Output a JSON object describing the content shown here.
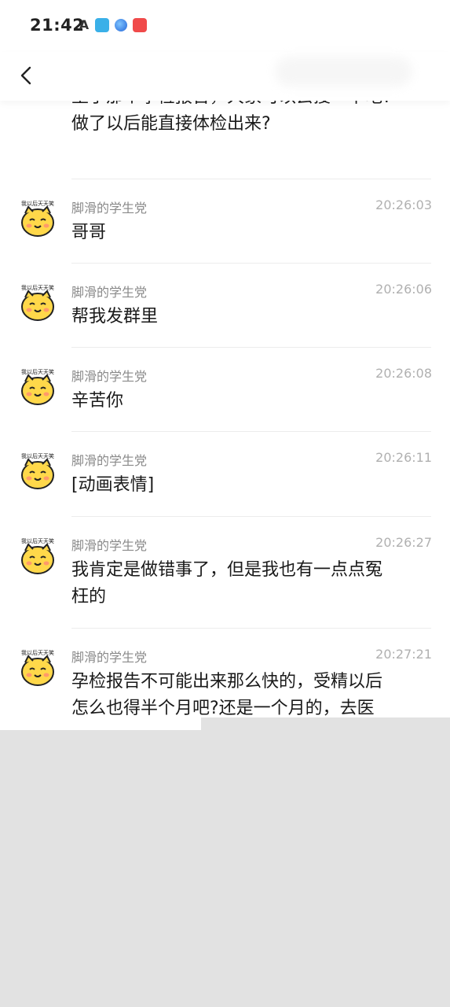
{
  "status_bar": {
    "time": "21:42",
    "icons": [
      "a-icon",
      "book-app-icon",
      "globe-app-icon",
      "video-app-icon"
    ]
  },
  "header": {
    "back_icon": "chevron-left-icon"
  },
  "continuation_message": {
    "text": "至于那个孕检报告，大家可以去搜一下吧?\n做了以后能直接体检出来?"
  },
  "messages": [
    {
      "avatar_caption": "我以后天天笑",
      "sender": "脚滑的学生党",
      "time": "20:26:03",
      "text": "哥哥"
    },
    {
      "avatar_caption": "我以后天天笑",
      "sender": "脚滑的学生党",
      "time": "20:26:06",
      "text": "帮我发群里"
    },
    {
      "avatar_caption": "我以后天天笑",
      "sender": "脚滑的学生党",
      "time": "20:26:08",
      "text": "辛苦你"
    },
    {
      "avatar_caption": "我以后天天笑",
      "sender": "脚滑的学生党",
      "time": "20:26:11",
      "text": "[动画表情]"
    },
    {
      "avatar_caption": "我以后天天笑",
      "sender": "脚滑的学生党",
      "time": "20:26:27",
      "text": "我肯定是做错事了，但是我也有一点点冤\n枉的"
    },
    {
      "avatar_caption": "我以后天天笑",
      "sender": "脚滑的学生党",
      "time": "20:27:21",
      "text": "孕检报告不可能出来那么快的，受精以后\n怎么也得半个月吧?还是一个月的，去医"
    }
  ],
  "colors": {
    "background": "#ffffff",
    "meta_text": "#8a8a8a",
    "time_text": "#b0b0b0",
    "divider": "#ececec",
    "footer_gray": "#e2e2e2"
  }
}
